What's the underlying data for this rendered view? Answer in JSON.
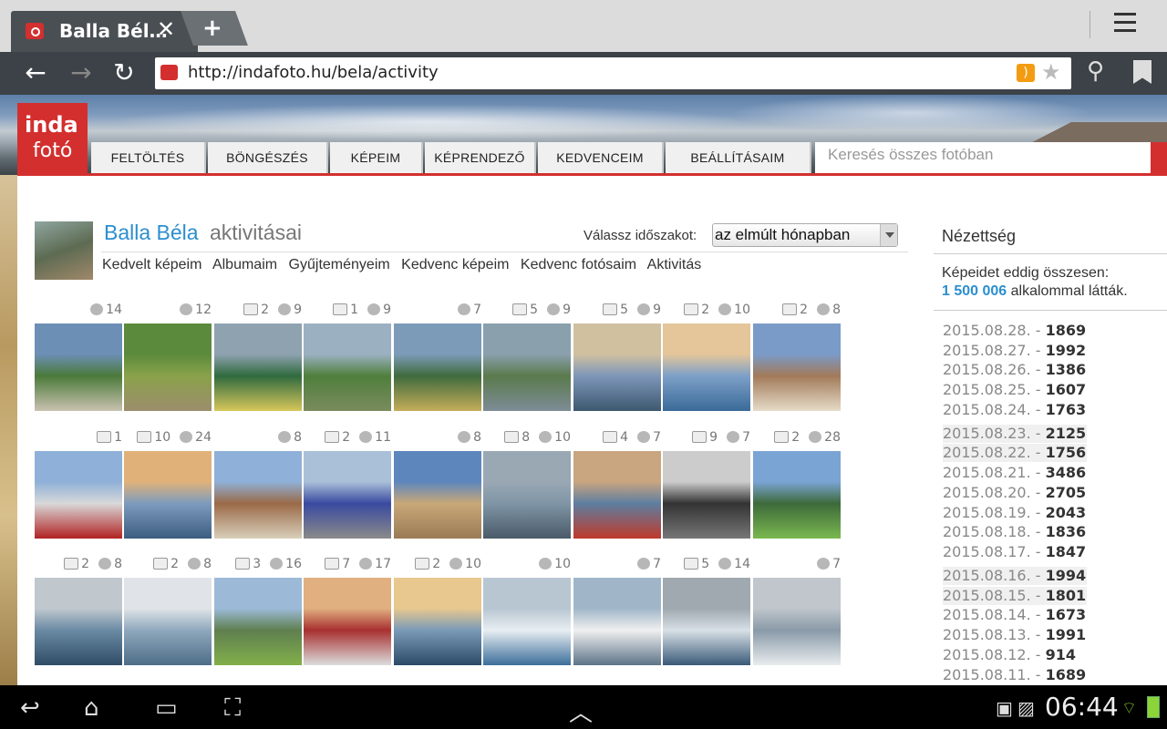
{
  "browser": {
    "tab_title": "Balla Bél…",
    "tab_close": "✕",
    "new_tab": "+",
    "url": "http://indafoto.hu/bela/activity"
  },
  "site": {
    "logo_top": "inda",
    "logo_bottom": "fotó",
    "nav": [
      "FELTÖLTÉS",
      "BÖNGÉSZÉS",
      "KÉPEIM",
      "KÉPRENDEZŐ",
      "KEDVENCEIM",
      "BEÁLLÍTÁSAIM"
    ],
    "search_placeholder": "Keresés összes fotóban"
  },
  "profile": {
    "name": "Balla Béla",
    "suffix": "aktivitásai",
    "period_label": "Válassz időszakot:",
    "period_value": "az elmúlt hónapban",
    "subnav": [
      "Kedvelt képeim",
      "Albumaim",
      "Gyűjteményeim",
      "Kedvenc képeim",
      "Kedvenc fotósaim",
      "Aktivitás"
    ]
  },
  "photos": [
    [
      {
        "comments": "",
        "likes": "14",
        "colors": [
          "#6c8fb5",
          "#4b7a3a",
          "#c9c2b0"
        ]
      },
      {
        "comments": "",
        "likes": "12",
        "colors": [
          "#5b8a3c",
          "#8aa24a",
          "#9c8d6c"
        ]
      },
      {
        "comments": "2",
        "likes": "9",
        "colors": [
          "#8fa2b0",
          "#2f6a3e",
          "#d7c75a"
        ]
      },
      {
        "comments": "1",
        "likes": "9",
        "colors": [
          "#9bb1c2",
          "#4f7f3c",
          "#7a8b5e"
        ]
      },
      {
        "comments": "",
        "likes": "7",
        "colors": [
          "#7c9bb8",
          "#3f6b3d",
          "#c5ad5a"
        ]
      },
      {
        "comments": "5",
        "likes": "9",
        "colors": [
          "#8aa0ad",
          "#5a7a4c",
          "#7d8c97"
        ]
      },
      {
        "comments": "5",
        "likes": "9",
        "colors": [
          "#d0c0a0",
          "#7d96b8",
          "#3d5870"
        ]
      },
      {
        "comments": "2",
        "likes": "10",
        "colors": [
          "#e4c69a",
          "#7da0c8",
          "#3a6a98"
        ]
      },
      {
        "comments": "2",
        "likes": "8",
        "colors": [
          "#7a9bc8",
          "#a27a5a",
          "#e6dcc8"
        ]
      }
    ],
    [
      {
        "comments": "1",
        "likes": "",
        "colors": [
          "#8fb0d8",
          "#d8d8d8",
          "#b22222"
        ]
      },
      {
        "comments": "10",
        "likes": "24",
        "colors": [
          "#e0b27a",
          "#7d9bbd",
          "#3c5c80"
        ]
      },
      {
        "comments": "",
        "likes": "8",
        "colors": [
          "#8fb0d8",
          "#9a6a48",
          "#d9cfba"
        ]
      },
      {
        "comments": "2",
        "likes": "11",
        "colors": [
          "#aac0d8",
          "#3a4aa0",
          "#8a8a8a"
        ]
      },
      {
        "comments": "",
        "likes": "8",
        "colors": [
          "#5d86bd",
          "#c8a878",
          "#9a7a55"
        ]
      },
      {
        "comments": "8",
        "likes": "10",
        "colors": [
          "#9aa8b4",
          "#7f95a6",
          "#4a5a68"
        ]
      },
      {
        "comments": "4",
        "likes": "7",
        "colors": [
          "#c9a580",
          "#5d7ea0",
          "#c0392b"
        ]
      },
      {
        "comments": "9",
        "likes": "7",
        "colors": [
          "#cccccc",
          "#333333",
          "#777777"
        ]
      },
      {
        "comments": "2",
        "likes": "28",
        "colors": [
          "#7aa4d4",
          "#3d6a3a",
          "#7ab850"
        ]
      }
    ],
    [
      {
        "comments": "2",
        "likes": "8",
        "colors": [
          "#c0c8ce",
          "#6a8aa4",
          "#2f4c66"
        ]
      },
      {
        "comments": "2",
        "likes": "8",
        "colors": [
          "#e0e4e8",
          "#8fa8bd",
          "#4d6d88"
        ]
      },
      {
        "comments": "3",
        "likes": "16",
        "colors": [
          "#9cbad8",
          "#5f7f50",
          "#82b04a"
        ]
      },
      {
        "comments": "7",
        "likes": "17",
        "colors": [
          "#e0b080",
          "#a83030",
          "#dcdcdc"
        ]
      },
      {
        "comments": "2",
        "likes": "10",
        "colors": [
          "#e8c88e",
          "#7a9ab8",
          "#2a4a68"
        ]
      },
      {
        "comments": "",
        "likes": "10",
        "colors": [
          "#b8c6d2",
          "#e8eef2",
          "#3c6e9a"
        ]
      },
      {
        "comments": "",
        "likes": "7",
        "colors": [
          "#a0b6c8",
          "#f0f0f0",
          "#5d7488"
        ]
      },
      {
        "comments": "5",
        "likes": "14",
        "colors": [
          "#a0a8b0",
          "#d8e0e6",
          "#3a5a78"
        ]
      },
      {
        "comments": "",
        "likes": "7",
        "colors": [
          "#c0c6cc",
          "#8a9aa8",
          "#e8ecee"
        ]
      }
    ]
  ],
  "views": {
    "title": "Nézettség",
    "line1": "Képeidet eddig összesen:",
    "count": "1 500 006",
    "line2": "alkalommal látták.",
    "daily": [
      {
        "date": "2015.08.28. -",
        "count": "1869"
      },
      {
        "date": "2015.08.27. -",
        "count": "1992"
      },
      {
        "date": "2015.08.26. -",
        "count": "1386"
      },
      {
        "date": "2015.08.25. -",
        "count": "1607"
      },
      {
        "date": "2015.08.24. -",
        "count": "1763"
      },
      {
        "date": "2015.08.23. -",
        "count": "2125"
      },
      {
        "date": "2015.08.22. -",
        "count": "1756"
      },
      {
        "date": "2015.08.21. -",
        "count": "3486"
      },
      {
        "date": "2015.08.20. -",
        "count": "2705"
      },
      {
        "date": "2015.08.19. -",
        "count": "2043"
      },
      {
        "date": "2015.08.18. -",
        "count": "1836"
      },
      {
        "date": "2015.08.17. -",
        "count": "1847"
      },
      {
        "date": "2015.08.16. -",
        "count": "1994"
      },
      {
        "date": "2015.08.15. -",
        "count": "1801"
      },
      {
        "date": "2015.08.14. -",
        "count": "1673"
      },
      {
        "date": "2015.08.13. -",
        "count": "1991"
      },
      {
        "date": "2015.08.12. -",
        "count": "914"
      },
      {
        "date": "2015.08.11. -",
        "count": "1689"
      }
    ],
    "shaded_rows": [
      5,
      6,
      12,
      13
    ]
  },
  "system": {
    "clock": "06:44"
  }
}
